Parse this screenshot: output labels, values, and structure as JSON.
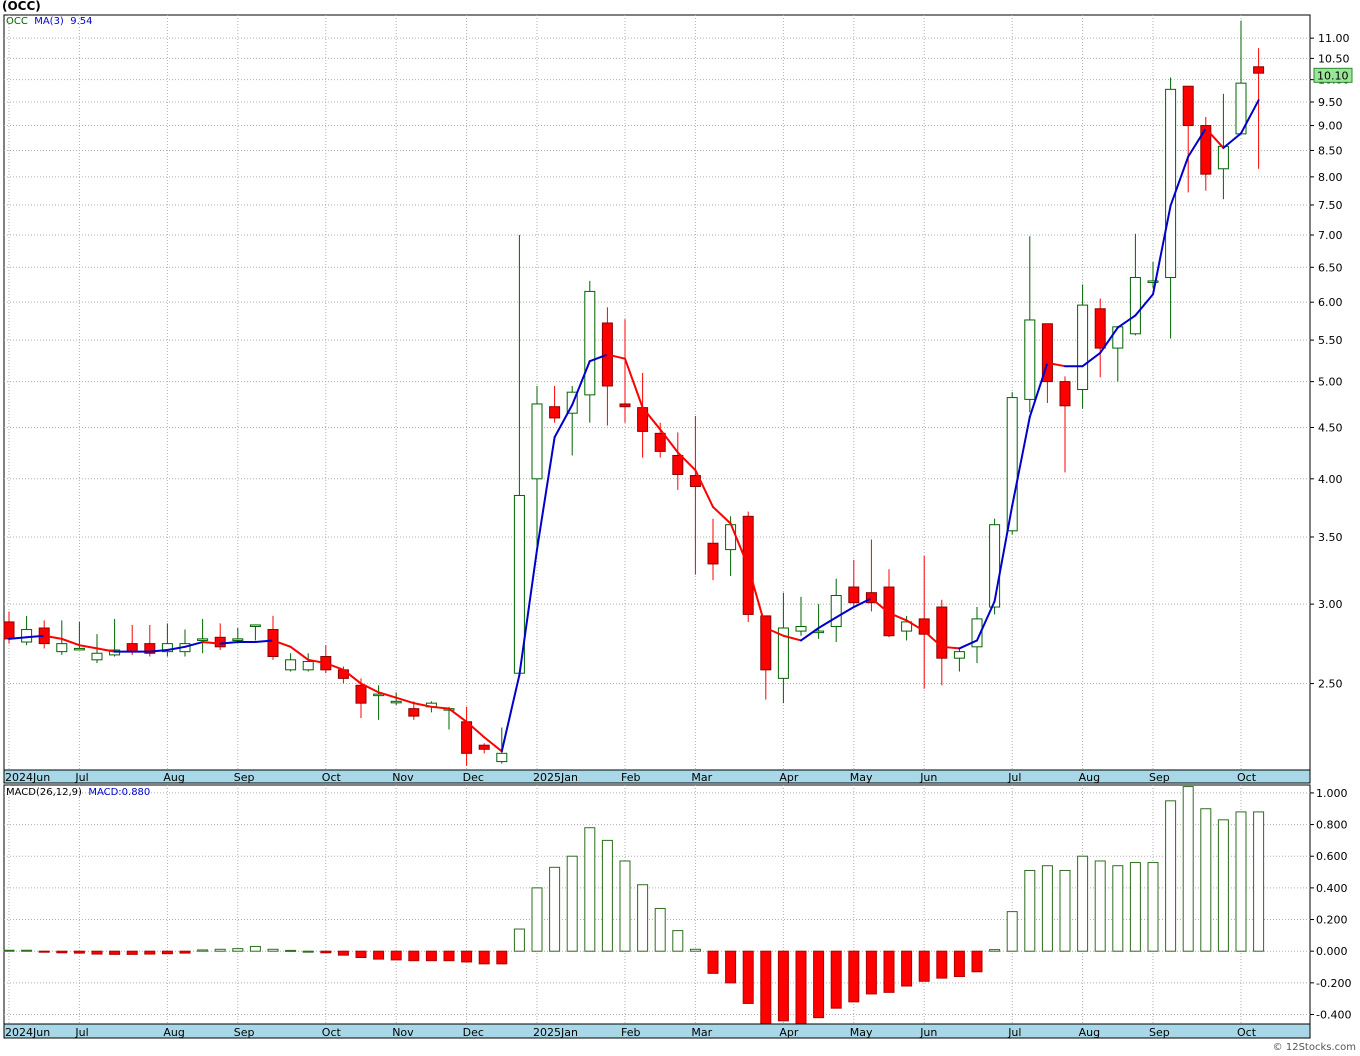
{
  "ticker_label": "(OCC)",
  "credit": "© 12Stocks.com",
  "price_legend": {
    "symbol": "OCC",
    "ma_label": "MA(3)",
    "ma_value": "9.54"
  },
  "macd_legend": {
    "label": "MACD(26,12,9)",
    "value_text": "MACD:0.880"
  },
  "colors": {
    "up": "#006400",
    "down": "#ff0000",
    "ma_rising": "#0000cc",
    "ma_falling": "#ff0000",
    "macd_pos": "#2e6e1e",
    "macd_neg": "#ff0000",
    "last_price_bg": "#99e699",
    "axis_band": "#a8d8e8"
  },
  "chart_data": [
    {
      "type": "candlestick",
      "title": "(OCC)",
      "scale": "log",
      "ylim": [
        2.05,
        11.6
      ],
      "ytick_labels": [
        "2.50",
        "3.00",
        "3.50",
        "4.00",
        "4.50",
        "5.00",
        "5.50",
        "6.00",
        "6.50",
        "7.00",
        "7.50",
        "8.00",
        "8.50",
        "9.00",
        "9.50",
        "10.00",
        "10.50",
        "11.00"
      ],
      "last_price": "10.10",
      "x_axis_labels": [
        "2024Jun",
        "Jul",
        "Aug",
        "Sep",
        "Oct",
        "Nov",
        "Dec",
        "2025Jan",
        "Feb",
        "Mar",
        "Apr",
        "May",
        "Jun",
        "Jul",
        "Aug",
        "Sep",
        "Oct"
      ],
      "month_index": [
        0,
        4,
        9,
        13,
        18,
        22,
        26,
        30,
        35,
        39,
        44,
        48,
        52,
        57,
        61,
        65,
        70
      ],
      "grid": true,
      "candles": [
        {
          "o": 2.88,
          "h": 2.95,
          "l": 2.74,
          "c": 2.77
        },
        {
          "o": 2.75,
          "h": 2.92,
          "l": 2.73,
          "c": 2.83
        },
        {
          "o": 2.84,
          "h": 2.89,
          "l": 2.71,
          "c": 2.74
        },
        {
          "o": 2.69,
          "h": 2.89,
          "l": 2.67,
          "c": 2.74
        },
        {
          "o": 2.71,
          "h": 2.88,
          "l": 2.7,
          "c": 2.71
        },
        {
          "o": 2.64,
          "h": 2.8,
          "l": 2.62,
          "c": 2.68
        },
        {
          "o": 2.67,
          "h": 2.9,
          "l": 2.66,
          "c": 2.7
        },
        {
          "o": 2.74,
          "h": 2.86,
          "l": 2.67,
          "c": 2.69
        },
        {
          "o": 2.74,
          "h": 2.86,
          "l": 2.66,
          "c": 2.68
        },
        {
          "o": 2.69,
          "h": 2.87,
          "l": 2.66,
          "c": 2.74
        },
        {
          "o": 2.69,
          "h": 2.83,
          "l": 2.66,
          "c": 2.74
        },
        {
          "o": 2.76,
          "h": 2.9,
          "l": 2.68,
          "c": 2.77
        },
        {
          "o": 2.78,
          "h": 2.87,
          "l": 2.7,
          "c": 2.72
        },
        {
          "o": 2.76,
          "h": 2.84,
          "l": 2.74,
          "c": 2.77
        },
        {
          "o": 2.85,
          "h": 2.86,
          "l": 2.76,
          "c": 2.86
        },
        {
          "o": 2.83,
          "h": 2.92,
          "l": 2.64,
          "c": 2.66
        },
        {
          "o": 2.58,
          "h": 2.68,
          "l": 2.57,
          "c": 2.64
        },
        {
          "o": 2.58,
          "h": 2.68,
          "l": 2.57,
          "c": 2.63
        },
        {
          "o": 2.66,
          "h": 2.73,
          "l": 2.56,
          "c": 2.58
        },
        {
          "o": 2.58,
          "h": 2.6,
          "l": 2.5,
          "c": 2.53
        },
        {
          "o": 2.49,
          "h": 2.53,
          "l": 2.31,
          "c": 2.39
        },
        {
          "o": 2.44,
          "h": 2.49,
          "l": 2.3,
          "c": 2.44
        },
        {
          "o": 2.4,
          "h": 2.45,
          "l": 2.38,
          "c": 2.4
        },
        {
          "o": 2.36,
          "h": 2.4,
          "l": 2.3,
          "c": 2.32
        },
        {
          "o": 2.37,
          "h": 2.4,
          "l": 2.34,
          "c": 2.39
        },
        {
          "o": 2.36,
          "h": 2.37,
          "l": 2.25,
          "c": 2.36
        },
        {
          "o": 2.29,
          "h": 2.37,
          "l": 2.07,
          "c": 2.13
        },
        {
          "o": 2.17,
          "h": 2.18,
          "l": 2.13,
          "c": 2.15
        },
        {
          "o": 2.09,
          "h": 2.26,
          "l": 2.08,
          "c": 2.13
        },
        {
          "o": 2.56,
          "h": 7.0,
          "l": 2.54,
          "c": 3.85
        },
        {
          "o": 4.0,
          "h": 4.95,
          "l": 3.4,
          "c": 4.75
        },
        {
          "o": 4.72,
          "h": 4.95,
          "l": 4.55,
          "c": 4.6
        },
        {
          "o": 4.65,
          "h": 4.95,
          "l": 4.22,
          "c": 4.88
        },
        {
          "o": 4.85,
          "h": 6.3,
          "l": 4.55,
          "c": 6.15
        },
        {
          "o": 5.72,
          "h": 5.93,
          "l": 4.52,
          "c": 4.95
        },
        {
          "o": 4.75,
          "h": 5.77,
          "l": 4.55,
          "c": 4.72
        },
        {
          "o": 4.71,
          "h": 5.1,
          "l": 4.2,
          "c": 4.46
        },
        {
          "o": 4.44,
          "h": 4.55,
          "l": 4.2,
          "c": 4.26
        },
        {
          "o": 4.22,
          "h": 4.45,
          "l": 3.9,
          "c": 4.04
        },
        {
          "o": 4.03,
          "h": 4.62,
          "l": 3.21,
          "c": 3.93
        },
        {
          "o": 3.45,
          "h": 3.65,
          "l": 3.17,
          "c": 3.29
        },
        {
          "o": 3.4,
          "h": 3.67,
          "l": 3.2,
          "c": 3.6
        },
        {
          "o": 3.67,
          "h": 3.71,
          "l": 2.88,
          "c": 2.93
        },
        {
          "o": 2.92,
          "h": 2.92,
          "l": 2.41,
          "c": 2.58
        },
        {
          "o": 2.53,
          "h": 3.08,
          "l": 2.39,
          "c": 2.84
        },
        {
          "o": 2.82,
          "h": 3.05,
          "l": 2.79,
          "c": 2.85
        },
        {
          "o": 2.81,
          "h": 3.0,
          "l": 2.77,
          "c": 2.82
        },
        {
          "o": 2.85,
          "h": 3.18,
          "l": 2.75,
          "c": 3.06
        },
        {
          "o": 3.12,
          "h": 3.32,
          "l": 2.98,
          "c": 3.01
        },
        {
          "o": 3.08,
          "h": 3.48,
          "l": 2.95,
          "c": 3.01
        },
        {
          "o": 3.12,
          "h": 3.25,
          "l": 2.78,
          "c": 2.79
        },
        {
          "o": 2.82,
          "h": 2.92,
          "l": 2.76,
          "c": 2.88
        },
        {
          "o": 2.9,
          "h": 3.35,
          "l": 2.47,
          "c": 2.8
        },
        {
          "o": 2.98,
          "h": 3.03,
          "l": 2.49,
          "c": 2.65
        },
        {
          "o": 2.65,
          "h": 2.71,
          "l": 2.57,
          "c": 2.69
        },
        {
          "o": 2.72,
          "h": 2.98,
          "l": 2.62,
          "c": 2.9
        },
        {
          "o": 2.98,
          "h": 3.65,
          "l": 2.93,
          "c": 3.6
        },
        {
          "o": 3.55,
          "h": 4.88,
          "l": 3.52,
          "c": 4.82
        },
        {
          "o": 4.8,
          "h": 6.98,
          "l": 4.66,
          "c": 5.76
        },
        {
          "o": 5.71,
          "h": 5.71,
          "l": 4.76,
          "c": 5.0
        },
        {
          "o": 5.0,
          "h": 5.06,
          "l": 4.06,
          "c": 4.73
        },
        {
          "o": 4.91,
          "h": 6.25,
          "l": 4.7,
          "c": 5.96
        },
        {
          "o": 5.91,
          "h": 6.05,
          "l": 5.05,
          "c": 5.4
        },
        {
          "o": 5.4,
          "h": 5.68,
          "l": 5.0,
          "c": 5.67
        },
        {
          "o": 5.58,
          "h": 7.02,
          "l": 5.56,
          "c": 6.35
        },
        {
          "o": 6.3,
          "h": 6.58,
          "l": 6.2,
          "c": 6.3
        },
        {
          "o": 6.35,
          "h": 10.05,
          "l": 5.52,
          "c": 9.78
        },
        {
          "o": 9.85,
          "h": 9.85,
          "l": 7.72,
          "c": 9.0
        },
        {
          "o": 9.0,
          "h": 9.18,
          "l": 7.75,
          "c": 8.05
        },
        {
          "o": 8.15,
          "h": 9.68,
          "l": 7.6,
          "c": 8.58
        },
        {
          "o": 8.83,
          "h": 11.45,
          "l": 8.82,
          "c": 9.92
        },
        {
          "o": 10.3,
          "h": 10.75,
          "l": 8.15,
          "c": 10.15
        }
      ],
      "ma": [
        2.77,
        2.78,
        2.79,
        2.77,
        2.73,
        2.71,
        2.69,
        2.69,
        2.69,
        2.7,
        2.72,
        2.75,
        2.74,
        2.75,
        2.75,
        2.76,
        2.72,
        2.64,
        2.62,
        2.58,
        2.5,
        2.45,
        2.42,
        2.39,
        2.37,
        2.36,
        2.29,
        2.21,
        2.14,
        2.55,
        3.4,
        4.4,
        4.74,
        5.24,
        5.32,
        5.27,
        4.71,
        4.48,
        4.25,
        4.08,
        3.75,
        3.61,
        3.27,
        2.84,
        2.79,
        2.76,
        2.84,
        2.91,
        2.98,
        3.04,
        2.94,
        2.89,
        2.82,
        2.72,
        2.71,
        2.76,
        3.02,
        3.76,
        4.61,
        5.22,
        5.18,
        5.18,
        5.34,
        5.66,
        5.82,
        6.11,
        7.49,
        8.38,
        8.94,
        8.55,
        8.84,
        9.54
      ]
    },
    {
      "type": "bar",
      "title": "MACD(26,12,9)",
      "ylim": [
        -0.46,
        1.05
      ],
      "ytick_labels": [
        "-0.400",
        "-0.200",
        "0.000",
        "0.200",
        "0.400",
        "0.600",
        "0.800",
        "1.000"
      ],
      "values": [
        0.006,
        0.006,
        -0.003,
        -0.01,
        -0.012,
        -0.018,
        -0.02,
        -0.02,
        -0.018,
        -0.016,
        -0.012,
        0.008,
        0.012,
        0.016,
        0.03,
        0.012,
        0.005,
        0.0,
        -0.01,
        -0.025,
        -0.04,
        -0.05,
        -0.055,
        -0.06,
        -0.06,
        -0.06,
        -0.068,
        -0.08,
        -0.08,
        0.14,
        0.4,
        0.53,
        0.6,
        0.78,
        0.7,
        0.57,
        0.42,
        0.27,
        0.13,
        0.012,
        -0.14,
        -0.2,
        -0.33,
        -0.46,
        -0.44,
        -0.46,
        -0.42,
        -0.36,
        -0.32,
        -0.27,
        -0.26,
        -0.22,
        -0.19,
        -0.17,
        -0.16,
        -0.13,
        0.01,
        0.25,
        0.51,
        0.54,
        0.51,
        0.6,
        0.57,
        0.54,
        0.56,
        0.56,
        0.95,
        1.04,
        0.9,
        0.83,
        0.88,
        0.88
      ]
    }
  ]
}
